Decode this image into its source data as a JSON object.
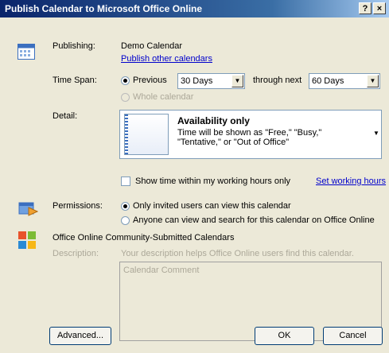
{
  "window": {
    "title": "Publish Calendar to Microsoft Office Online",
    "help_btn": "?",
    "close_btn": "×"
  },
  "publishing": {
    "label": "Publishing:",
    "calendar_name": "Demo Calendar",
    "link": "Publish other calendars"
  },
  "time_span": {
    "label": "Time Span:",
    "previous_label": "Previous",
    "previous_value": "30 Days",
    "through_next_label": "through next",
    "through_next_value": "60 Days",
    "whole_calendar_label": "Whole calendar"
  },
  "detail": {
    "label": "Detail:",
    "option_title": "Availability only",
    "option_desc": "Time will be shown as \"Free,\" \"Busy,\" \"Tentative,\" or \"Out of Office\""
  },
  "working_hours": {
    "checkbox_label": "Show time within my working hours only",
    "link": "Set working hours"
  },
  "permissions": {
    "label": "Permissions:",
    "option1": "Only invited users can view this calendar",
    "option2": "Anyone can view and search for this calendar on Office Online"
  },
  "community": {
    "heading": "Office Online Community-Submitted Calendars",
    "description_label": "Description:",
    "description_hint": "Your description helps Office Online users find this calendar.",
    "textarea_placeholder": "Calendar Comment"
  },
  "buttons": {
    "advanced": "Advanced...",
    "ok": "OK",
    "cancel": "Cancel"
  }
}
